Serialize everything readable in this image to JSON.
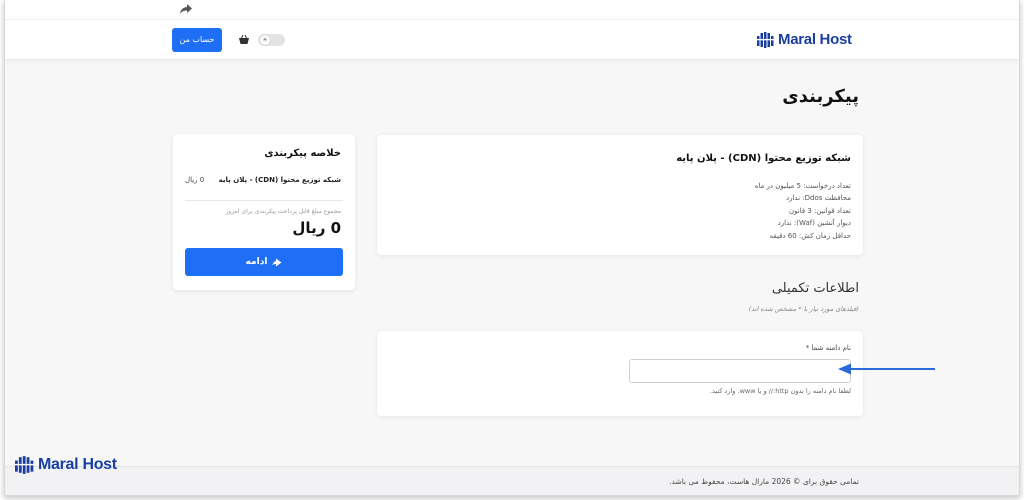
{
  "header": {
    "logo_text": "Maral Host",
    "account_button": "حساب من",
    "theme_toggle_glyph": "☀"
  },
  "page": {
    "title": "پیکربندی"
  },
  "product": {
    "name": "شبکه توزیع محتوا (CDN) - پلان پایه",
    "features": [
      "تعداد درخواست: 5 میلیون در ماه",
      "محافظت Ddos: ندارد",
      "تعداد قوانین: 3 قانون",
      "دیوار آتشین (Waf): ندارد",
      "حداقل زمان کش: 60 دقیقه"
    ]
  },
  "extra": {
    "title": "اطلاعات تکمیلی",
    "required_note": "(فیلدهای مورد نیاز با * مشخص شده اند)",
    "domain_label": "نام دامنه شما *",
    "domain_value": "",
    "domain_help": "لطفا نام دامنه را بدون http:// و یا www. وارد کنید."
  },
  "summary": {
    "title": "خلاصه پیکربندی",
    "item_name": "شبکه توزیع محتوا (CDN) - پلان پایه",
    "item_price": "0 ریال",
    "due_label": "مجموع مبلغ قابل پرداخت پیکربندی برای امروز",
    "total": "0 ریال",
    "continue_button": "ادامه"
  },
  "footer": {
    "logo_text": "Maral Host",
    "copyright": "تمامی حقوق برای © 2026 مارال هاست، محفوظ می باشد."
  },
  "colors": {
    "primary": "#1e6ff5",
    "brand_navy": "#1a3fa0",
    "arrow": "#2a6ad8"
  }
}
